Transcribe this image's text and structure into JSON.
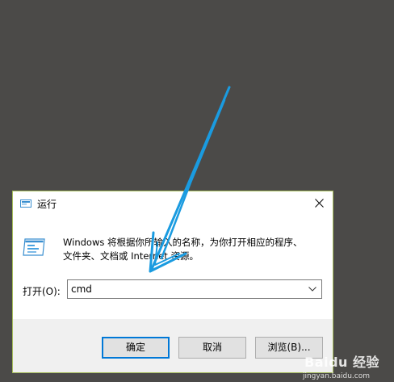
{
  "dialog": {
    "title": "运行",
    "description": "Windows 将根据你所输入的名称，为你打开相应的程序、\n文件夹、文档或 Internet 资源。",
    "open_label": "打开(O):",
    "input_value": "cmd",
    "buttons": {
      "ok": "确定",
      "cancel": "取消",
      "browse": "浏览(B)..."
    }
  },
  "watermark": {
    "text": "Baidu 经验",
    "sub": "jingyan.baidu.com"
  },
  "colors": {
    "desktop": "#4b4a48",
    "annotation_arrow": "#1a9be0",
    "primary_border": "#0078d7"
  }
}
